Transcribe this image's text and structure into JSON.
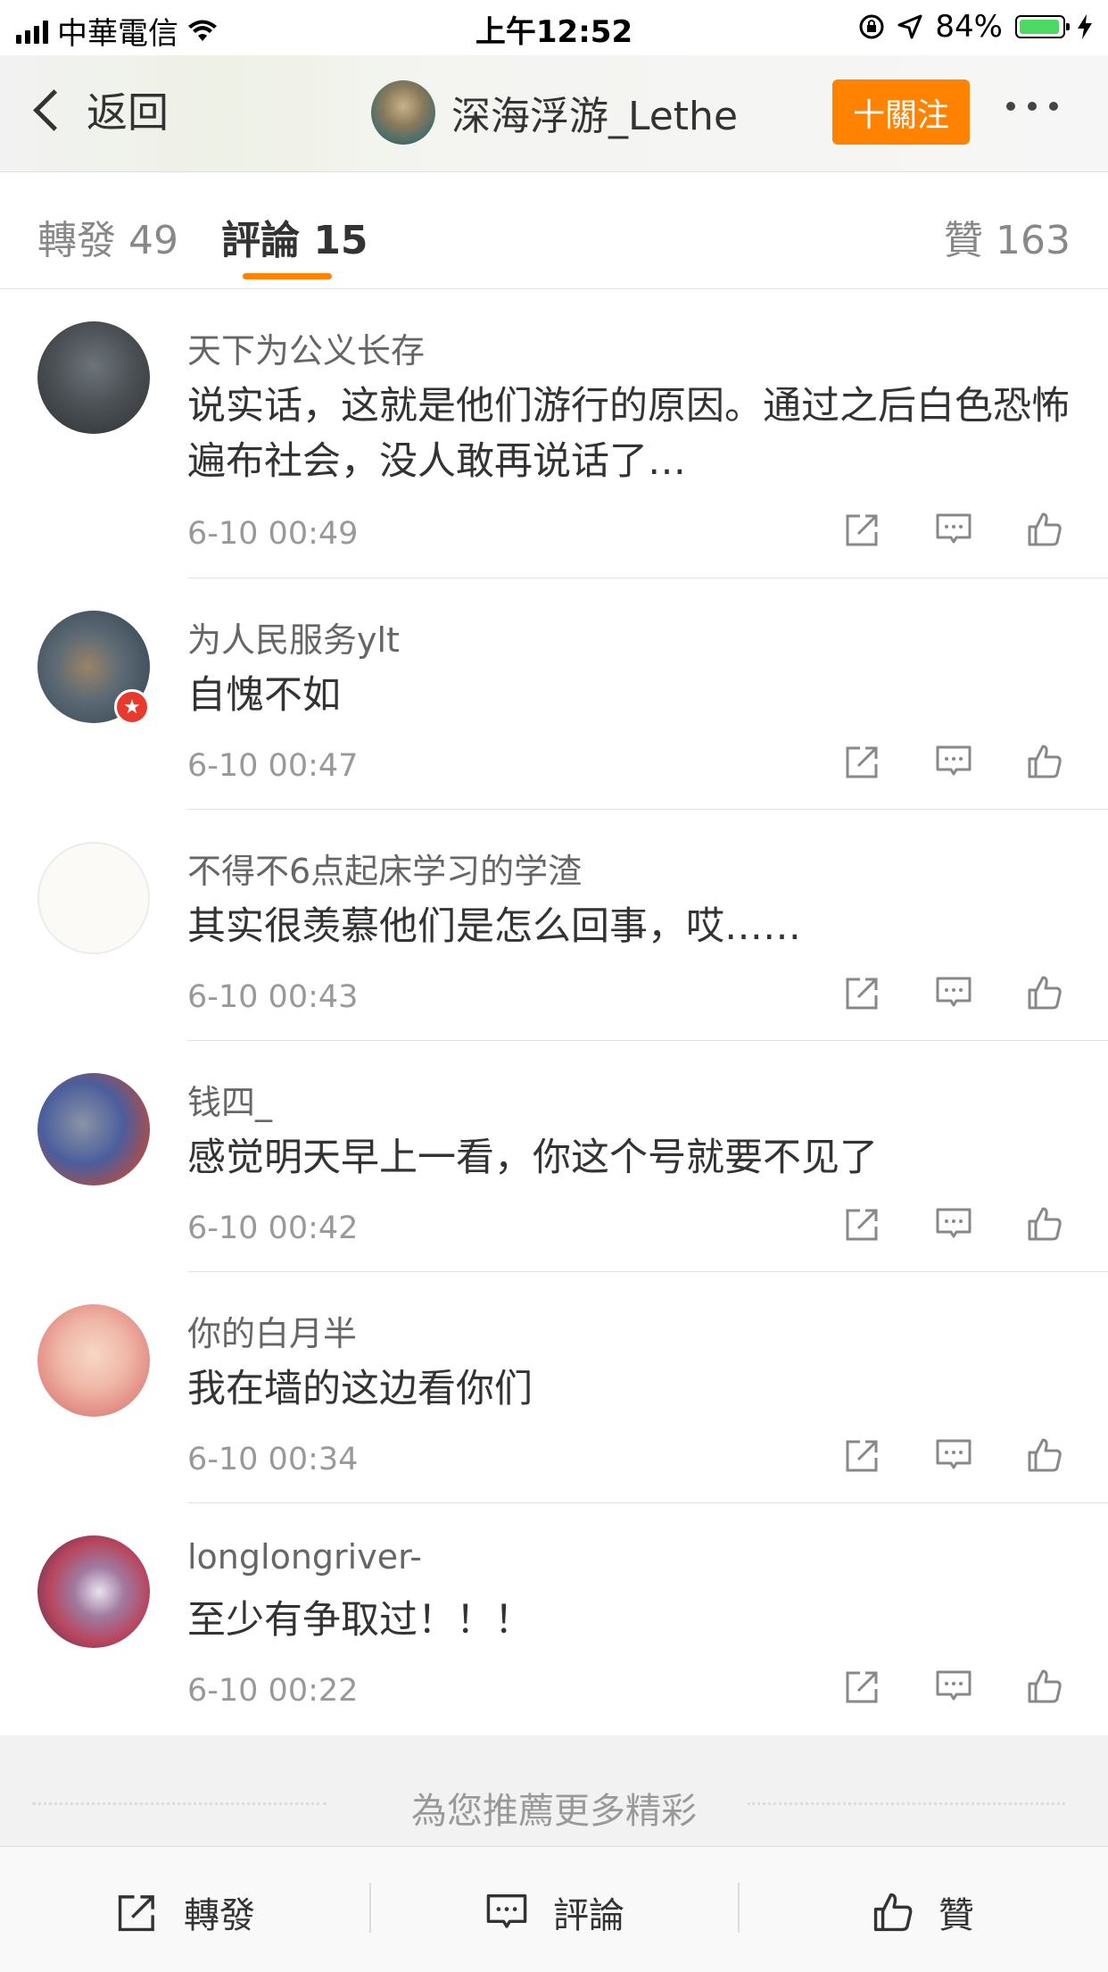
{
  "status_bar": {
    "carrier": "中華電信",
    "time": "上午12:52",
    "battery_percent": "84%",
    "battery_level": 0.84
  },
  "nav": {
    "back_label": "返回",
    "username": "深海浮游_Lethe",
    "follow_label": "十關注"
  },
  "tabs": [
    {
      "label": "轉發 49",
      "active": false
    },
    {
      "label": "評論 15",
      "active": true
    },
    {
      "label": "贊 163",
      "active": false
    }
  ],
  "comments": [
    {
      "user": "天下为公义长存",
      "text": "说实话，这就是他们游行的原因。通过之后白色恐怖遍布社会，没人敢再说话了…",
      "time": "6-10 00:49"
    },
    {
      "user": "为人民服务ylt",
      "text": "自愧不如",
      "time": "6-10 00:47"
    },
    {
      "user": "不得不6点起床学习的学渣",
      "text": "其实很羡慕他们是怎么回事，哎……",
      "time": "6-10 00:43"
    },
    {
      "user": "钱四_",
      "text": "感觉明天早上一看，你这个号就要不见了",
      "time": "6-10 00:42"
    },
    {
      "user": "你的白月半",
      "text": "我在墙的这边看你们",
      "time": "6-10 00:34"
    },
    {
      "user": "longlongriver-",
      "text": "至少有争取过！！！",
      "time": "6-10 00:22"
    }
  ],
  "recommend_text": "為您推薦更多精彩",
  "toolbar": {
    "repost_label": "轉發",
    "comment_label": "評論",
    "like_label": "贊"
  },
  "colors": {
    "accent": "#ff8200",
    "badge_red": "#e83a2c"
  }
}
